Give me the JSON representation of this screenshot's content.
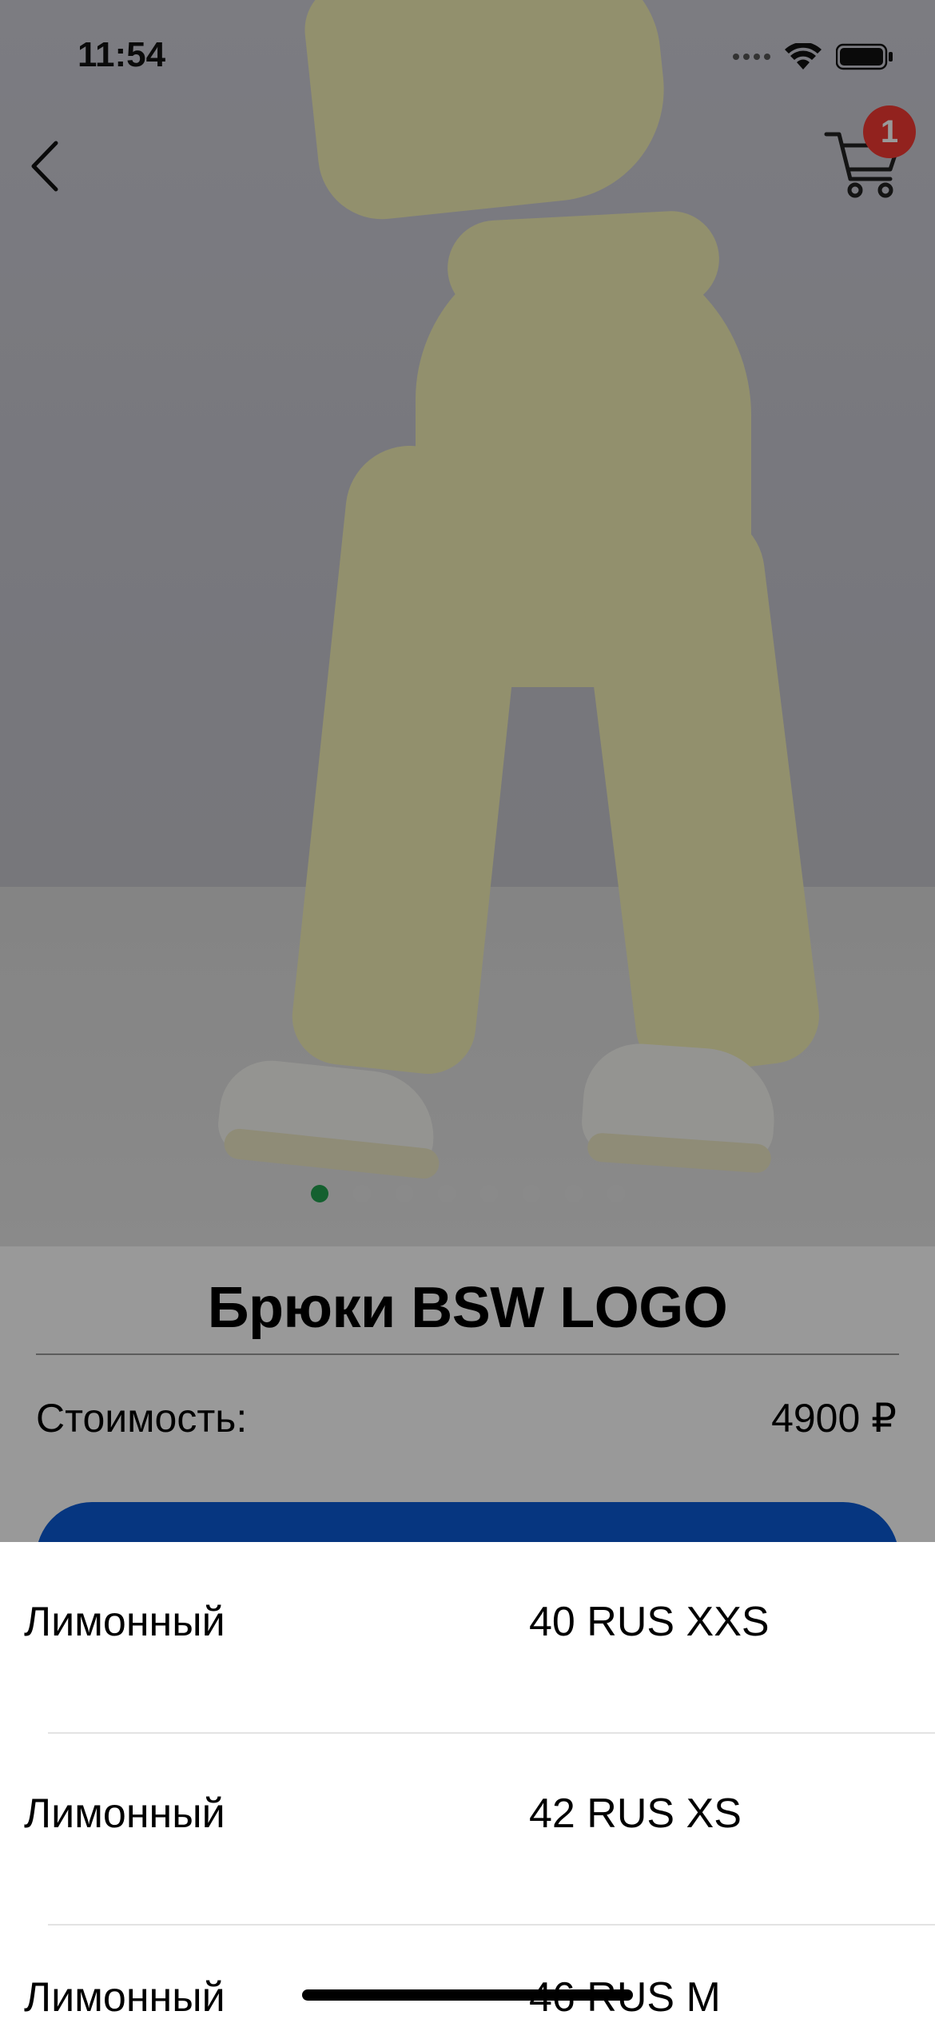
{
  "status_bar": {
    "time": "11:54"
  },
  "nav": {
    "back_icon": "chevron-left-icon",
    "cart_icon": "cart-icon",
    "cart_count": "1"
  },
  "gallery": {
    "page_count": 8,
    "active_index": 0,
    "active_color": "#22a14f"
  },
  "product": {
    "title": "Брюки BSW LOGO",
    "price_label": "Стоимость:",
    "price_value": "4900 ₽"
  },
  "colors": {
    "accent": "#0b5ad6",
    "badge": "#f33a33"
  },
  "size_sheet": {
    "options": [
      {
        "color": "Лимонный",
        "size": "40 RUS XXS"
      },
      {
        "color": "Лимонный",
        "size": "42 RUS XS"
      },
      {
        "color": "Лимонный",
        "size": "46 RUS M"
      }
    ]
  }
}
